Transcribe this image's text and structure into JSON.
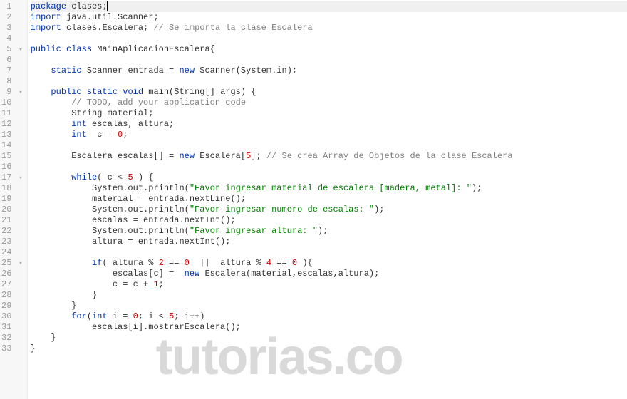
{
  "watermark": "tutorias.co",
  "lines": [
    {
      "n": 1,
      "fold": "",
      "hl": true,
      "tokens": [
        {
          "t": "package",
          "c": "kw"
        },
        {
          "t": " clases;",
          "c": "txt"
        }
      ]
    },
    {
      "n": 2,
      "fold": "",
      "tokens": [
        {
          "t": "import",
          "c": "kw"
        },
        {
          "t": " java.util.Scanner;",
          "c": "txt"
        }
      ]
    },
    {
      "n": 3,
      "fold": "",
      "tokens": [
        {
          "t": "import",
          "c": "kw"
        },
        {
          "t": " clases.Escalera; ",
          "c": "txt"
        },
        {
          "t": "// Se importa la clase Escalera",
          "c": "cmt"
        }
      ]
    },
    {
      "n": 4,
      "fold": "",
      "tokens": []
    },
    {
      "n": 5,
      "fold": "▾",
      "tokens": [
        {
          "t": "public class",
          "c": "kw"
        },
        {
          "t": " MainAplicacionEscalera{",
          "c": "txt"
        }
      ]
    },
    {
      "n": 6,
      "fold": "",
      "tokens": []
    },
    {
      "n": 7,
      "fold": "",
      "tokens": [
        {
          "t": "    ",
          "c": "txt"
        },
        {
          "t": "static",
          "c": "kw"
        },
        {
          "t": " Scanner entrada = ",
          "c": "txt"
        },
        {
          "t": "new",
          "c": "kw"
        },
        {
          "t": " Scanner(System.in);",
          "c": "txt"
        }
      ]
    },
    {
      "n": 8,
      "fold": "",
      "tokens": []
    },
    {
      "n": 9,
      "fold": "▾",
      "tokens": [
        {
          "t": "    ",
          "c": "txt"
        },
        {
          "t": "public static void",
          "c": "kw"
        },
        {
          "t": " main(String[] args) {",
          "c": "txt"
        }
      ]
    },
    {
      "n": 10,
      "fold": "",
      "tokens": [
        {
          "t": "        ",
          "c": "txt"
        },
        {
          "t": "// TODO, add your application code",
          "c": "cmt"
        }
      ]
    },
    {
      "n": 11,
      "fold": "",
      "tokens": [
        {
          "t": "        String material;",
          "c": "txt"
        }
      ]
    },
    {
      "n": 12,
      "fold": "",
      "tokens": [
        {
          "t": "        ",
          "c": "txt"
        },
        {
          "t": "int",
          "c": "kw"
        },
        {
          "t": " escalas, altura;",
          "c": "txt"
        }
      ]
    },
    {
      "n": 13,
      "fold": "",
      "tokens": [
        {
          "t": "        ",
          "c": "txt"
        },
        {
          "t": "int",
          "c": "kw"
        },
        {
          "t": "  c = ",
          "c": "txt"
        },
        {
          "t": "0",
          "c": "num"
        },
        {
          "t": ";",
          "c": "txt"
        }
      ]
    },
    {
      "n": 14,
      "fold": "",
      "tokens": []
    },
    {
      "n": 15,
      "fold": "",
      "tokens": [
        {
          "t": "        Escalera escalas[] = ",
          "c": "txt"
        },
        {
          "t": "new",
          "c": "kw"
        },
        {
          "t": " Escalera[",
          "c": "txt"
        },
        {
          "t": "5",
          "c": "num"
        },
        {
          "t": "]; ",
          "c": "txt"
        },
        {
          "t": "// Se crea Array de Objetos de la clase Escalera",
          "c": "cmt"
        }
      ]
    },
    {
      "n": 16,
      "fold": "",
      "tokens": []
    },
    {
      "n": 17,
      "fold": "▾",
      "tokens": [
        {
          "t": "        ",
          "c": "txt"
        },
        {
          "t": "while",
          "c": "kw"
        },
        {
          "t": "( c < ",
          "c": "txt"
        },
        {
          "t": "5",
          "c": "num"
        },
        {
          "t": " ) {",
          "c": "txt"
        }
      ]
    },
    {
      "n": 18,
      "fold": "",
      "tokens": [
        {
          "t": "            System.out.println(",
          "c": "txt"
        },
        {
          "t": "\"Favor ingresar material de escalera [madera, metal]: \"",
          "c": "str"
        },
        {
          "t": ");",
          "c": "txt"
        }
      ]
    },
    {
      "n": 19,
      "fold": "",
      "tokens": [
        {
          "t": "            material = entrada.nextLine();",
          "c": "txt"
        }
      ]
    },
    {
      "n": 20,
      "fold": "",
      "tokens": [
        {
          "t": "            System.out.println(",
          "c": "txt"
        },
        {
          "t": "\"Favor ingresar numero de escalas: \"",
          "c": "str"
        },
        {
          "t": ");",
          "c": "txt"
        }
      ]
    },
    {
      "n": 21,
      "fold": "",
      "tokens": [
        {
          "t": "            escalas = entrada.nextInt();",
          "c": "txt"
        }
      ]
    },
    {
      "n": 22,
      "fold": "",
      "tokens": [
        {
          "t": "            System.out.println(",
          "c": "txt"
        },
        {
          "t": "\"Favor ingresar altura: \"",
          "c": "str"
        },
        {
          "t": ");",
          "c": "txt"
        }
      ]
    },
    {
      "n": 23,
      "fold": "",
      "tokens": [
        {
          "t": "            altura = entrada.nextInt();",
          "c": "txt"
        }
      ]
    },
    {
      "n": 24,
      "fold": "",
      "tokens": []
    },
    {
      "n": 25,
      "fold": "▾",
      "tokens": [
        {
          "t": "            ",
          "c": "txt"
        },
        {
          "t": "if",
          "c": "kw"
        },
        {
          "t": "( altura % ",
          "c": "txt"
        },
        {
          "t": "2",
          "c": "num"
        },
        {
          "t": " == ",
          "c": "txt"
        },
        {
          "t": "0",
          "c": "num"
        },
        {
          "t": "  ||  altura % ",
          "c": "txt"
        },
        {
          "t": "4",
          "c": "num"
        },
        {
          "t": " == ",
          "c": "txt"
        },
        {
          "t": "0",
          "c": "num"
        },
        {
          "t": " ){",
          "c": "txt"
        }
      ]
    },
    {
      "n": 26,
      "fold": "",
      "tokens": [
        {
          "t": "                escalas[c] =  ",
          "c": "txt"
        },
        {
          "t": "new",
          "c": "kw"
        },
        {
          "t": " Escalera(material,escalas,altura);",
          "c": "txt"
        }
      ]
    },
    {
      "n": 27,
      "fold": "",
      "tokens": [
        {
          "t": "                c = c + ",
          "c": "txt"
        },
        {
          "t": "1",
          "c": "num"
        },
        {
          "t": ";",
          "c": "txt"
        }
      ]
    },
    {
      "n": 28,
      "fold": "",
      "tokens": [
        {
          "t": "            }",
          "c": "txt"
        }
      ]
    },
    {
      "n": 29,
      "fold": "",
      "tokens": [
        {
          "t": "        }",
          "c": "txt"
        }
      ]
    },
    {
      "n": 30,
      "fold": "",
      "tokens": [
        {
          "t": "        ",
          "c": "txt"
        },
        {
          "t": "for",
          "c": "kw"
        },
        {
          "t": "(",
          "c": "txt"
        },
        {
          "t": "int",
          "c": "kw"
        },
        {
          "t": " i = ",
          "c": "txt"
        },
        {
          "t": "0",
          "c": "num"
        },
        {
          "t": "; i < ",
          "c": "txt"
        },
        {
          "t": "5",
          "c": "num"
        },
        {
          "t": "; i++)",
          "c": "txt"
        }
      ]
    },
    {
      "n": 31,
      "fold": "",
      "tokens": [
        {
          "t": "            escalas[i].mostrarEscalera();",
          "c": "txt"
        }
      ]
    },
    {
      "n": 32,
      "fold": "",
      "tokens": [
        {
          "t": "    }",
          "c": "txt"
        }
      ]
    },
    {
      "n": 33,
      "fold": "",
      "tokens": [
        {
          "t": "}",
          "c": "txt"
        }
      ]
    }
  ]
}
